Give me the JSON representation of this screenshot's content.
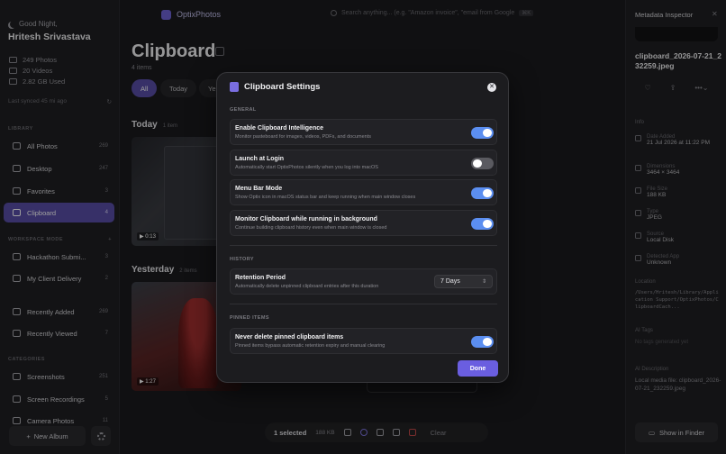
{
  "sidebar": {
    "greeting": "Good Night,",
    "user_name": "Hritesh Srivastava",
    "stats": [
      "249 Photos",
      "20 Videos",
      "2.82 GB Used"
    ],
    "last_synced": "Last synced 45 mi ago",
    "library_heading": "LIBRARY",
    "library_items": [
      {
        "label": "All Photos",
        "count": "269"
      },
      {
        "label": "Desktop",
        "count": "247"
      },
      {
        "label": "Favorites",
        "count": "3"
      },
      {
        "label": "Clipboard",
        "count": "4"
      }
    ],
    "workspace_heading": "WORKSPACE MODE",
    "workspace_items": [
      {
        "label": "Hackathon Submi...",
        "count": "3"
      },
      {
        "label": "My Client Delivery",
        "count": "2"
      }
    ],
    "recent_items": [
      {
        "label": "Recently Added",
        "count": "269"
      },
      {
        "label": "Recently Viewed",
        "count": "7"
      }
    ],
    "categories_heading": "CATEGORIES",
    "category_items": [
      {
        "label": "Screenshots",
        "count": "251"
      },
      {
        "label": "Screen Recordings",
        "count": "5"
      },
      {
        "label": "Camera Photos",
        "count": "11"
      }
    ],
    "new_album": "New Album"
  },
  "topbar": {
    "brand": "OptixPhotos",
    "search_placeholder": "Search anything... (e.g. \"Amazon invoice\", \"email from Google",
    "search_shortcut": "⌘K"
  },
  "main": {
    "title": "Clipboard",
    "count": "4 items",
    "filters": [
      "All",
      "Today",
      "Ye"
    ],
    "groups": [
      {
        "title": "Today",
        "count": "1 item",
        "duration": "0:13"
      },
      {
        "title": "Yesterday",
        "count": "2 items",
        "duration": "1:27"
      }
    ]
  },
  "bottombar": {
    "selected": "1 selected",
    "size": "188 KB",
    "clear": "Clear"
  },
  "inspector": {
    "title": "Metadata Inspector",
    "filename": "clipboard_2026-07-21_232259.jpeg",
    "info_heading": "Info",
    "date_label": "Date Added",
    "date_value": "21 Jul 2026 at 11:22 PM",
    "dimensions_label": "Dimensions",
    "dimensions_value": "3464 × 3464",
    "filesize_label": "File Size",
    "filesize_value": "188 KB",
    "type_label": "Type",
    "type_value": "JPEG",
    "source_label": "Source",
    "source_value": "Local Disk",
    "app_label": "Detected App",
    "app_value": "Unknown",
    "location_label": "Location",
    "location_value": "/Users/Hritesh/Library/Application Support/OptixPhotos/ClipboardCach...",
    "ai_tags_heading": "AI Tags",
    "ai_tags_value": "No tags generated yet",
    "ai_desc_heading": "AI Description",
    "ai_desc_value": "Local media file: clipboard_2026-07-21_232259.jpeg",
    "finder_button": "Show in Finder"
  },
  "modal": {
    "title": "Clipboard Settings",
    "general_heading": "GENERAL",
    "rows": [
      {
        "title": "Enable Clipboard Intelligence",
        "desc": "Monitor pasteboard for images, videos, PDFs, and documents",
        "on": true
      },
      {
        "title": "Launch at Login",
        "desc": "Automatically start OptixPhotos silently when you log into macOS",
        "on": false
      },
      {
        "title": "Menu Bar Mode",
        "desc": "Show Optix icon in macOS status bar and keep running when main window closes",
        "on": true
      },
      {
        "title": "Monitor Clipboard while running in background",
        "desc": "Continue building clipboard history even when main window is closed",
        "on": true
      }
    ],
    "history_heading": "HISTORY",
    "retention_title": "Retention Period",
    "retention_desc": "Automatically delete unpinned clipboard entries after this duration",
    "retention_value": "7 Days",
    "pinned_heading": "PINNED ITEMS",
    "pinned_title": "Never delete pinned clipboard items",
    "pinned_desc": "Pinned items bypass automatic retention expiry and manual clearing",
    "pinned_on": true,
    "done_label": "Done"
  },
  "colors": {
    "accent": "#5a4ea8",
    "toggle_on": "#5b8ef0",
    "done_button": "#6a5ee0"
  }
}
